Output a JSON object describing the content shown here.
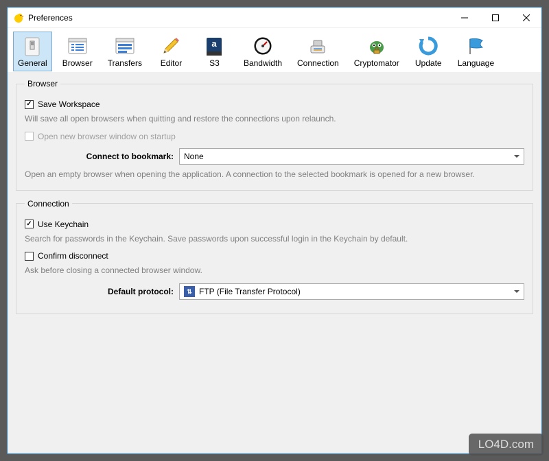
{
  "window": {
    "title": "Preferences"
  },
  "toolbar": {
    "items": [
      {
        "label": "General"
      },
      {
        "label": "Browser"
      },
      {
        "label": "Transfers"
      },
      {
        "label": "Editor"
      },
      {
        "label": "S3"
      },
      {
        "label": "Bandwidth"
      },
      {
        "label": "Connection"
      },
      {
        "label": "Cryptomator"
      },
      {
        "label": "Update"
      },
      {
        "label": "Language"
      }
    ]
  },
  "sections": {
    "browser": {
      "legend": "Browser",
      "save_workspace": {
        "label": "Save Workspace",
        "desc": "Will save all open browsers when quitting and restore the connections upon relaunch.",
        "checked": true
      },
      "open_new": {
        "label": "Open new browser window on startup",
        "checked": false,
        "disabled": true
      },
      "connect_bookmark": {
        "label": "Connect to bookmark:",
        "value": "None",
        "desc": "Open an empty browser when opening the application. A connection to the selected bookmark is opened for a new browser."
      }
    },
    "connection": {
      "legend": "Connection",
      "use_keychain": {
        "label": "Use Keychain",
        "desc": "Search for passwords in the Keychain. Save passwords upon successful login in the Keychain by default.",
        "checked": true
      },
      "confirm_disconnect": {
        "label": "Confirm disconnect",
        "desc": "Ask before closing a connected browser window.",
        "checked": false
      },
      "default_protocol": {
        "label": "Default protocol:",
        "value": "FTP (File Transfer Protocol)"
      }
    }
  },
  "watermark": "LO4D.com"
}
